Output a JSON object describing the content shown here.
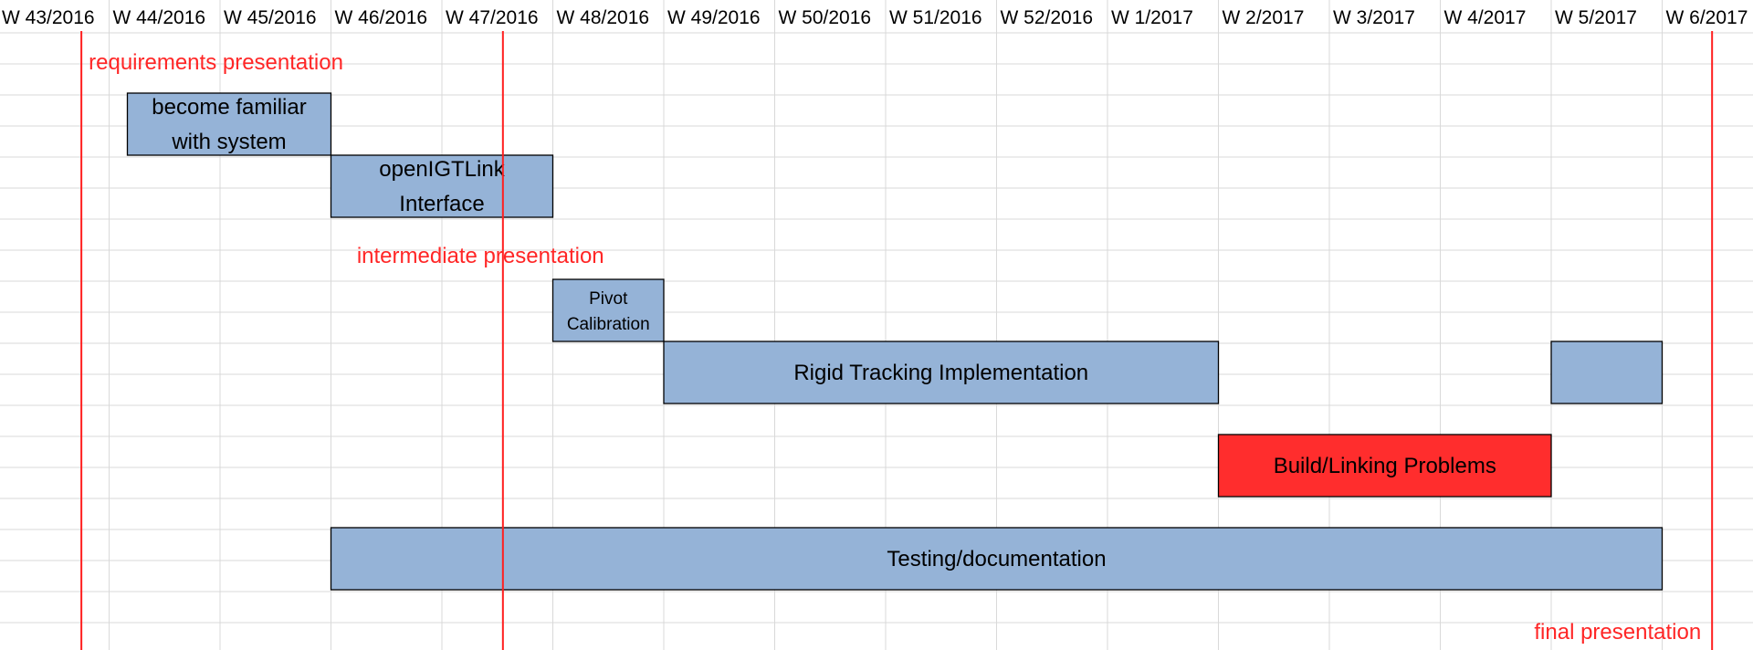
{
  "chart_data": {
    "type": "gantt",
    "weeks": [
      "W 43/2016",
      "W 44/2016",
      "W 45/2016",
      "W 46/2016",
      "W 47/2016",
      "W 48/2016",
      "W 49/2016",
      "W 50/2016",
      "W 51/2016",
      "W 52/2016",
      "W 1/2017",
      "W 2/2017",
      "W 3/2017",
      "W 4/2017",
      "W 5/2017",
      "W 6/2017"
    ],
    "milestones": [
      {
        "label": "requirements presentation",
        "week": "W 43/2016",
        "offset": 0.75
      },
      {
        "label": "intermediate presentation",
        "week": "W 47/2016",
        "offset": 0.55
      },
      {
        "label": "final presentation",
        "week": "W 6/2017",
        "offset": 0.45
      }
    ],
    "tasks": [
      {
        "lines": [
          "become familiar",
          "with system"
        ],
        "segments": [
          {
            "start": "W 44/2016",
            "end": "W 45/2016"
          }
        ],
        "color": "#95b3d7"
      },
      {
        "lines": [
          "openIGTLink",
          "Interface"
        ],
        "segments": [
          {
            "start": "W 46/2016",
            "end": "W 47/2016"
          }
        ],
        "color": "#95b3d7"
      },
      {
        "lines": [
          "Pivot",
          "Calibration"
        ],
        "segments": [
          {
            "start": "W 48/2016",
            "end": "W 48/2016"
          }
        ],
        "color": "#95b3d7"
      },
      {
        "lines": [
          "Rigid Tracking Implementation"
        ],
        "segments": [
          {
            "start": "W 49/2016",
            "end": "W 1/2017"
          },
          {
            "start": "W 5/2017",
            "end": "W 5/2017"
          }
        ],
        "color": "#95b3d7"
      },
      {
        "lines": [
          "Build/Linking Problems"
        ],
        "segments": [
          {
            "start": "W 2/2017",
            "end": "W 4/2017"
          }
        ],
        "color": "#ff2d2d"
      },
      {
        "lines": [
          "Testing/documentation"
        ],
        "segments": [
          {
            "start": "W 46/2016",
            "end": "W 5/2017"
          }
        ],
        "color": "#95b3d7"
      }
    ]
  }
}
